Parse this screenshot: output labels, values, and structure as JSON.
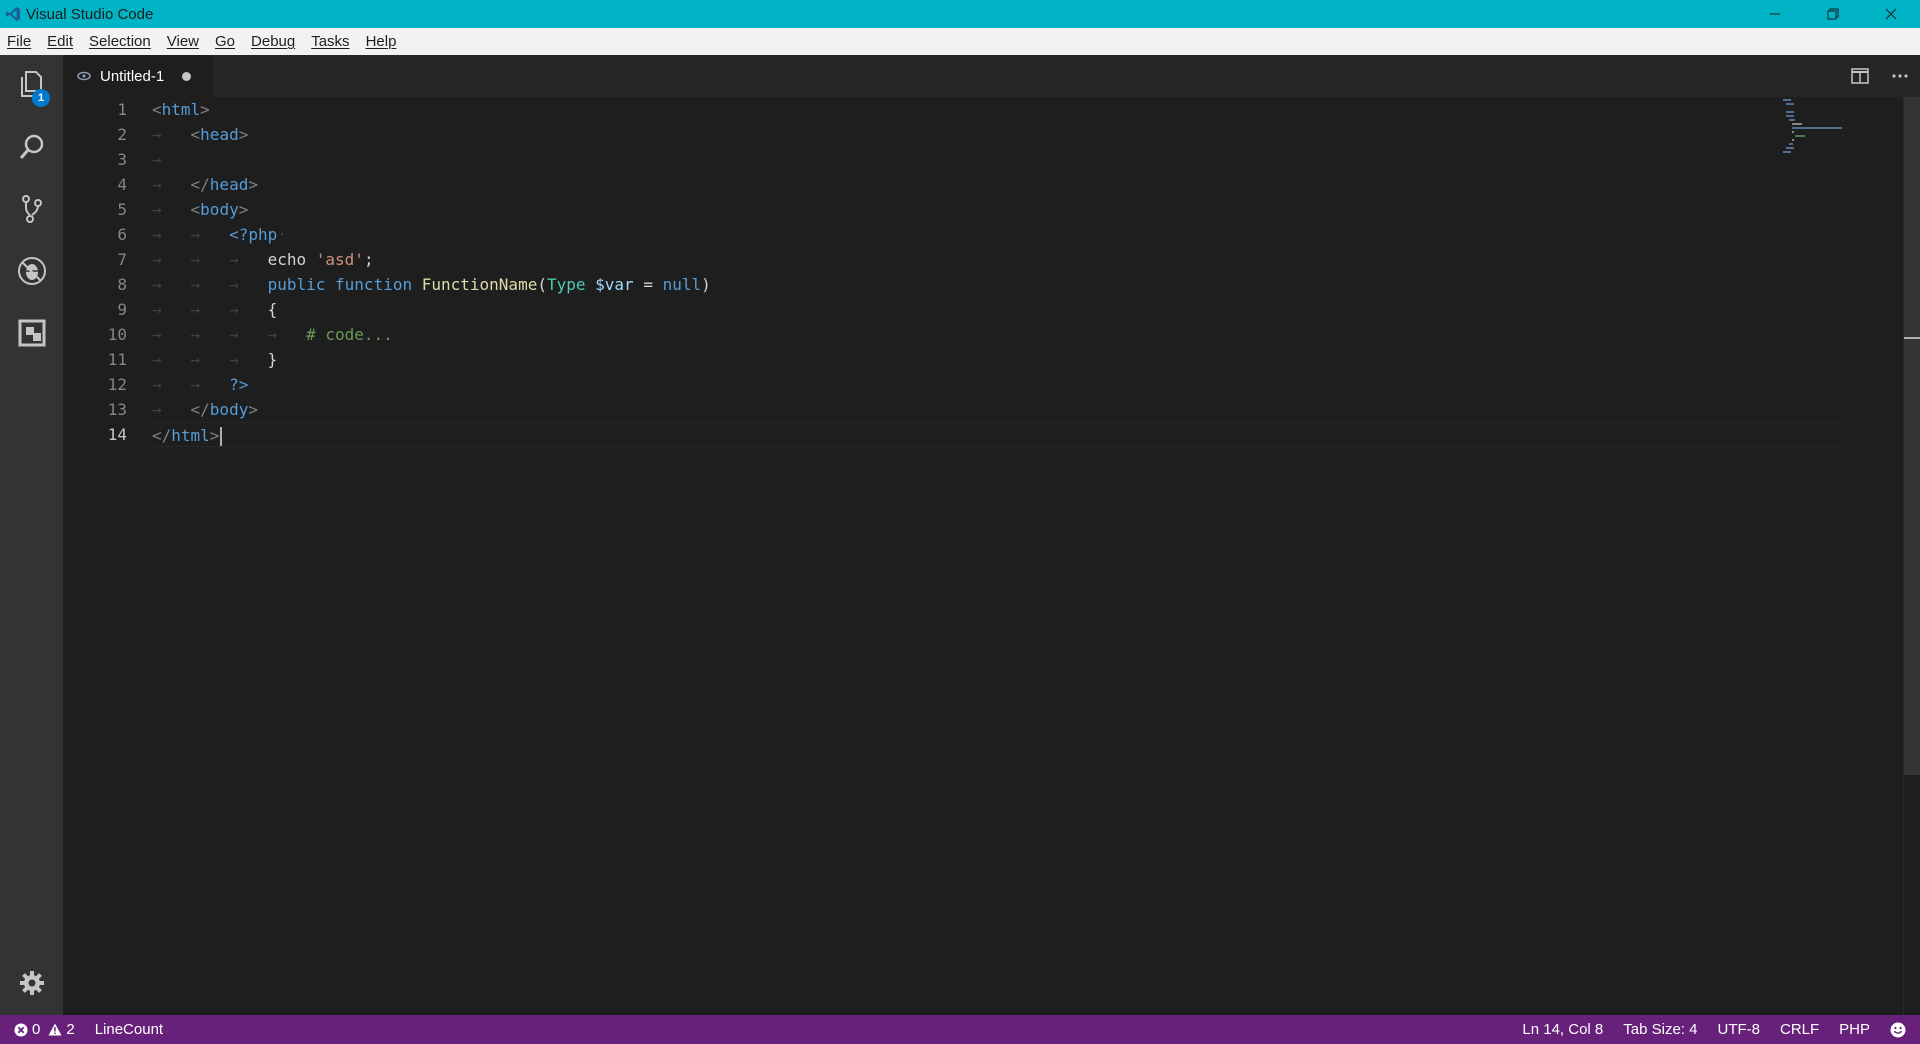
{
  "window": {
    "title": "Visual Studio Code",
    "controls": [
      "minimize",
      "restore",
      "close"
    ]
  },
  "menu": {
    "items": [
      "File",
      "Edit",
      "Selection",
      "View",
      "Go",
      "Debug",
      "Tasks",
      "Help"
    ]
  },
  "activity_bar": {
    "items": [
      {
        "name": "explorer",
        "icon": "files-icon",
        "badge": "1"
      },
      {
        "name": "search",
        "icon": "search-icon"
      },
      {
        "name": "source-control",
        "icon": "git-branch-icon"
      },
      {
        "name": "debug",
        "icon": "bug-icon"
      },
      {
        "name": "extensions",
        "icon": "extensions-icon"
      }
    ],
    "settings_icon": "gear-icon"
  },
  "tabs": [
    {
      "label": "Untitled-1",
      "dirty": true,
      "active": true
    }
  ],
  "editor": {
    "line_numbers": [
      "1",
      "2",
      "3",
      "4",
      "5",
      "6",
      "7",
      "8",
      "9",
      "10",
      "11",
      "12",
      "13",
      "14"
    ],
    "lines": [
      "<html>",
      "    <head>",
      "",
      "    </head>",
      "    <body>",
      "        <?php",
      "            echo 'asd';",
      "            public function FunctionName(Type $var = null)",
      "            {",
      "                # code...",
      "            }",
      "        ?>",
      "    </body>",
      "</html>"
    ],
    "cursor_line": 14
  },
  "status": {
    "errors": "0",
    "warnings": "2",
    "line_count": "LineCount",
    "position": "Ln 14, Col 8",
    "tab_size": "Tab Size: 4",
    "encoding": "UTF-8",
    "eol": "CRLF",
    "language": "PHP",
    "feedback_icon": "smiley-icon"
  },
  "colors": {
    "titlebar": "#00b4c6",
    "statusbar": "#68217a",
    "activity_bar": "#333333",
    "editor_bg": "#1e1e1e"
  }
}
